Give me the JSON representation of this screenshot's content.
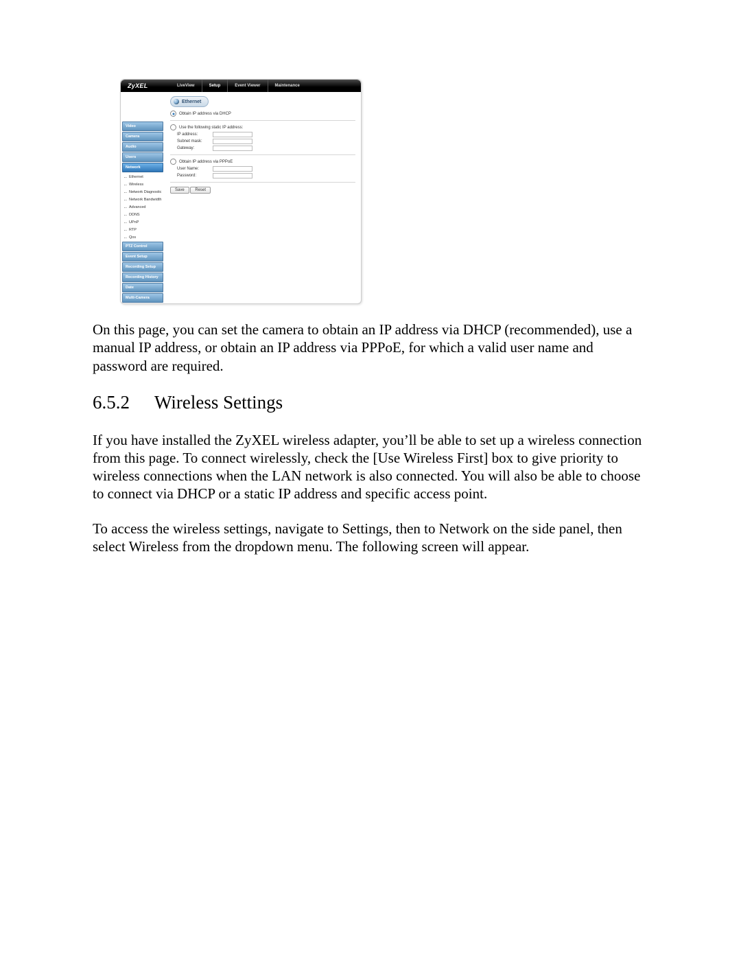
{
  "brand": "ZyXEL",
  "topnav": {
    "items": [
      "LiveView",
      "Setup",
      "Event Viewer",
      "Maintenance"
    ],
    "active_index": 1
  },
  "sidebar": {
    "groups": [
      {
        "label": "Video",
        "selected": false
      },
      {
        "label": "Camera",
        "selected": false
      },
      {
        "label": "Audio",
        "selected": false
      },
      {
        "label": "Users",
        "selected": false
      },
      {
        "label": "Network",
        "selected": true
      }
    ],
    "sub_items": [
      "Ethernet",
      "Wireless",
      "Network Diagnostic",
      "Network Bandwidth",
      "Advanced",
      "DDNS",
      "UPnP",
      "RTP",
      "Qos"
    ],
    "groups_after": [
      {
        "label": "PTZ Control"
      },
      {
        "label": "Event Setup"
      },
      {
        "label": "Recording Setup"
      },
      {
        "label": "Recording History"
      },
      {
        "label": "Date"
      },
      {
        "label": "Multi-Camera"
      }
    ]
  },
  "content": {
    "panel_title": "Ethernet",
    "radios": {
      "dhcp_label": "Obtain IP address via DHCP",
      "static_label": "Use the following static IP address:",
      "pppoe_label": "Obtain IP address via PPPoE",
      "checked": "dhcp"
    },
    "static_fields": {
      "ip_label": "IP address:",
      "subnet_label": "Subnet mask:",
      "gateway_label": "Gateway:"
    },
    "pppoe_fields": {
      "username_label": "User Name:",
      "password_label": "Password:"
    },
    "buttons": {
      "save": "Save",
      "reset": "Reset"
    }
  },
  "doc": {
    "para1": "On this page, you can set the camera to obtain an IP address via DHCP (recommended), use a manual IP address, or obtain an IP address via PPPoE, for which a valid user name and password are required.",
    "heading_num": "6.5.2",
    "heading_title": "Wireless Settings",
    "para2": "If you have installed the ZyXEL wireless adapter, you’ll be able to set up a wireless connection from this page. To connect wirelessly, check the [Use Wireless First] box to give priority to wireless connections when the LAN network is also connected. You will also be able to choose to connect via DHCP or a static IP address and specific access point.",
    "para3": "To access the wireless settings, navigate to Settings, then to Network on the side panel, then select Wireless from the dropdown menu. The following screen will appear."
  }
}
